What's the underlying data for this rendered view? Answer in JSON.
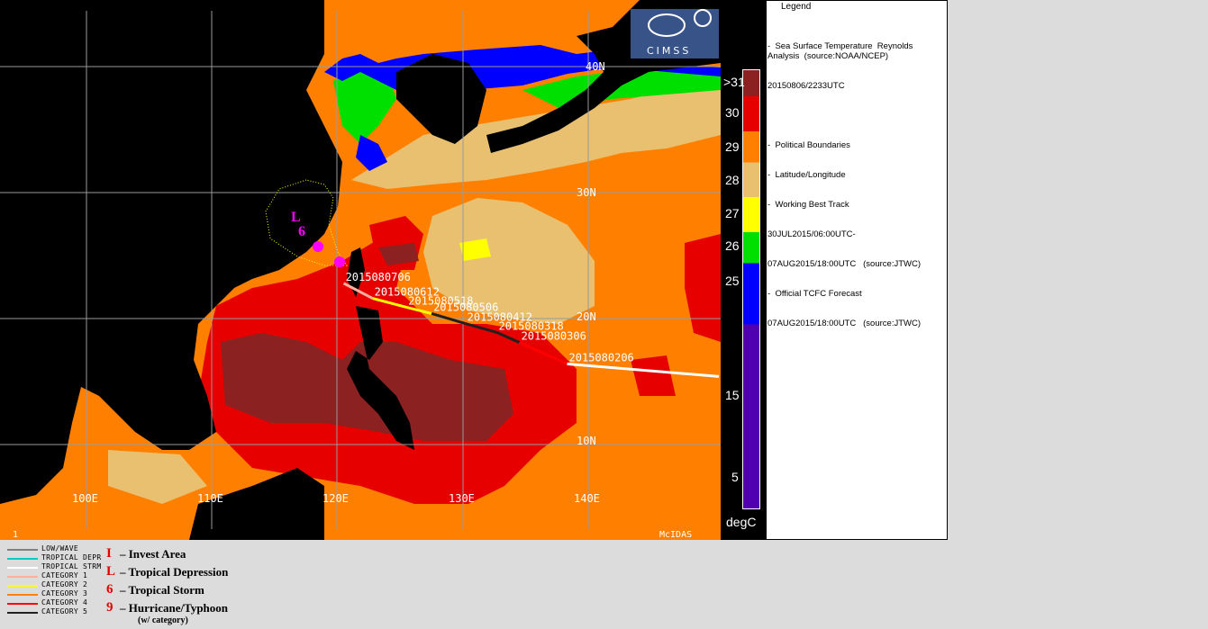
{
  "map": {
    "lat_labels": [
      "40N",
      "30N",
      "20N",
      "10N"
    ],
    "lon_labels": [
      "100E",
      "110E",
      "120E",
      "130E",
      "140E"
    ],
    "frame_number": "1",
    "software_label": "McIDAS",
    "logo_text": "CIMSS",
    "storm_track": {
      "points": [
        {
          "label": "2015080706",
          "lon": 120.5,
          "lat": 22.8
        },
        {
          "label": "2015080612",
          "lon": 122.8,
          "lat": 21.6
        },
        {
          "label": "2015080518",
          "lon": 125.5,
          "lat": 20.9
        },
        {
          "label": "2015080506",
          "lon": 127.5,
          "lat": 20.4
        },
        {
          "label": "2015080412",
          "lon": 130.2,
          "lat": 19.6
        },
        {
          "label": "2015080318",
          "lon": 132.7,
          "lat": 18.9
        },
        {
          "label": "2015080306",
          "lon": 134.5,
          "lat": 18.1
        },
        {
          "label": "2015080206",
          "lon": 138.3,
          "lat": 16.4
        }
      ]
    }
  },
  "colorbar": {
    "unit": "degC",
    "labels": [
      ">31",
      "30",
      "29",
      "28",
      "27",
      "26",
      "25",
      "15",
      "5"
    ],
    "colors": [
      "#8b2121",
      "#e60000",
      "#ff8000",
      "#e8c070",
      "#ffff00",
      "#00e000",
      "#0000ff",
      "#5000b0"
    ]
  },
  "legend": {
    "title": "Legend",
    "entries": [
      "-  Sea Surface Temperature  Reynolds Analysis  (source:NOAA/NCEP)",
      "20150806/2233UTC",
      "",
      "-  Political Boundaries",
      "-  Latitude/Longitude",
      "-  Working Best Track",
      "30JUL2015/06:00UTC-",
      "07AUG2015/18:00UTC   (source:JTWC)",
      "-  Official TCFC Forecast",
      "07AUG2015/18:00UTC   (source:JTWC)"
    ]
  },
  "track_legend": {
    "lines": [
      {
        "label": "LOW/WAVE",
        "color": "#808080"
      },
      {
        "label": "TROPICAL DEPR",
        "color": "#00c8c8"
      },
      {
        "label": "TROPICAL STRM",
        "color": "#ffffff"
      },
      {
        "label": "CATEGORY 1",
        "color": "#ffb0a0"
      },
      {
        "label": "CATEGORY 2",
        "color": "#ffff00"
      },
      {
        "label": "CATEGORY 3",
        "color": "#ff8000"
      },
      {
        "label": "CATEGORY 4",
        "color": "#ff0000"
      },
      {
        "label": "CATEGORY 5",
        "color": "#202020"
      }
    ],
    "symbols": [
      {
        "glyph": "I",
        "label": "– Invest Area"
      },
      {
        "glyph": "L",
        "label": "– Tropical Depression"
      },
      {
        "glyph": "6",
        "label": "– Tropical Storm"
      },
      {
        "glyph": "9",
        "label": "– Hurricane/Typhoon"
      }
    ],
    "note": "(w/ category)"
  }
}
